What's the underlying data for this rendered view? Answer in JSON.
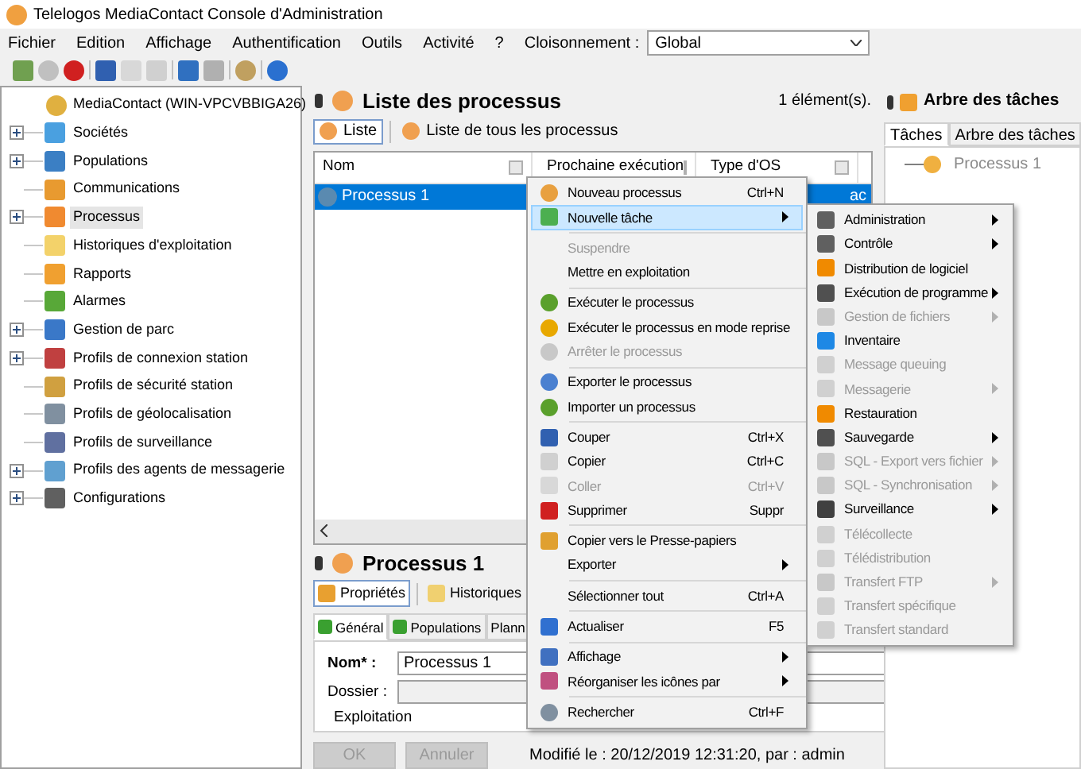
{
  "window": {
    "title": "Telelogos MediaContact Console d'Administration"
  },
  "menu_bar": {
    "items": [
      "Fichier",
      "Edition",
      "Affichage",
      "Authentification",
      "Outils",
      "Activité",
      "?"
    ],
    "partition_label": "Cloisonnement :",
    "partition_value": "Global"
  },
  "tree": {
    "root": "MediaContact (WIN-VPCVBBIGA26)",
    "items": [
      {
        "label": "Sociétés",
        "expandable": true,
        "selected": false
      },
      {
        "label": "Populations",
        "expandable": true,
        "selected": false
      },
      {
        "label": "Communications",
        "expandable": false,
        "selected": false
      },
      {
        "label": "Processus",
        "expandable": true,
        "selected": true
      },
      {
        "label": "Historiques d'exploitation",
        "expandable": false,
        "selected": false
      },
      {
        "label": "Rapports",
        "expandable": false,
        "selected": false
      },
      {
        "label": "Alarmes",
        "expandable": false,
        "selected": false
      },
      {
        "label": "Gestion de parc",
        "expandable": true,
        "selected": false
      },
      {
        "label": "Profils de connexion station",
        "expandable": true,
        "selected": false
      },
      {
        "label": "Profils de sécurité station",
        "expandable": false,
        "selected": false
      },
      {
        "label": "Profils de géolocalisation",
        "expandable": false,
        "selected": false
      },
      {
        "label": "Profils de surveillance",
        "expandable": false,
        "selected": false
      },
      {
        "label": "Profils des agents de messagerie",
        "expandable": true,
        "selected": false
      },
      {
        "label": "Configurations",
        "expandable": true,
        "selected": false
      }
    ]
  },
  "process_list": {
    "title": "Liste des processus",
    "count": "1 élément(s).",
    "views": [
      {
        "label": "Liste",
        "selected": true
      },
      {
        "label": "Liste de tous les processus",
        "selected": false
      }
    ],
    "columns": [
      "Nom",
      "Prochaine exécution",
      "Type d'OS"
    ],
    "rows": [
      {
        "name": "Processus 1",
        "column_4": "ac",
        "selected": true
      }
    ]
  },
  "details": {
    "title": "Processus 1",
    "tabs": [
      {
        "label": "Propriétés",
        "selected": true
      },
      {
        "label": "Historiques",
        "selected": false
      }
    ],
    "subtabs": [
      {
        "label": "Général",
        "selected": true
      },
      {
        "label": "Populations",
        "selected": false
      },
      {
        "label": "Plann",
        "selected": false
      }
    ],
    "fields": [
      {
        "label": "Nom* :",
        "required": true,
        "value": "Processus 1"
      },
      {
        "label": "Dossier :",
        "required": false
      }
    ],
    "group_label": "Exploitation",
    "buttons": [
      {
        "label": "OK",
        "disabled": true
      },
      {
        "label": "Annuler",
        "disabled": true
      }
    ],
    "modified": "Modifié le : 20/12/2019 12:31:20, par : admin"
  },
  "task_tree": {
    "title": "Arbre des tâches",
    "tabs": [
      {
        "label": "Tâches",
        "selected": true
      },
      {
        "label": "Arbre des tâches",
        "selected": false
      }
    ],
    "items": [
      "Processus 1"
    ]
  },
  "context_menu": {
    "items": [
      {
        "kind": "item",
        "label": "Nouveau processus",
        "shortcut": "Ctrl+N",
        "disabled": false,
        "submenu": false,
        "selected": false
      },
      {
        "kind": "item",
        "label": "Nouvelle tâche",
        "disabled": false,
        "submenu": true,
        "selected": true
      },
      {
        "kind": "separator"
      },
      {
        "kind": "item",
        "label": "Suspendre",
        "disabled": true,
        "submenu": false,
        "selected": false
      },
      {
        "kind": "item",
        "label": "Mettre en exploitation",
        "disabled": false,
        "submenu": false,
        "selected": false
      },
      {
        "kind": "separator"
      },
      {
        "kind": "item",
        "label": "Exécuter le processus",
        "disabled": false,
        "submenu": false,
        "selected": false
      },
      {
        "kind": "item",
        "label": "Exécuter le processus en mode reprise",
        "disabled": false,
        "submenu": false,
        "selected": false
      },
      {
        "kind": "item",
        "label": "Arrêter le processus",
        "disabled": true,
        "submenu": false,
        "selected": false
      },
      {
        "kind": "separator"
      },
      {
        "kind": "item",
        "label": "Exporter le processus",
        "disabled": false,
        "submenu": false,
        "selected": false
      },
      {
        "kind": "item",
        "label": "Importer un processus",
        "disabled": false,
        "submenu": false,
        "selected": false
      },
      {
        "kind": "separator"
      },
      {
        "kind": "item",
        "label": "Couper",
        "shortcut": "Ctrl+X",
        "disabled": false,
        "submenu": false,
        "selected": false
      },
      {
        "kind": "item",
        "label": "Copier",
        "shortcut": "Ctrl+C",
        "disabled": false,
        "submenu": false,
        "selected": false
      },
      {
        "kind": "item",
        "label": "Coller",
        "shortcut": "Ctrl+V",
        "disabled": true,
        "submenu": false,
        "selected": false
      },
      {
        "kind": "item",
        "label": "Supprimer",
        "shortcut": "Suppr",
        "disabled": false,
        "submenu": false,
        "selected": false
      },
      {
        "kind": "separator"
      },
      {
        "kind": "item",
        "label": "Copier vers le Presse-papiers",
        "disabled": false,
        "submenu": false,
        "selected": false
      },
      {
        "kind": "item",
        "label": "Exporter",
        "disabled": false,
        "submenu": true,
        "selected": false
      },
      {
        "kind": "separator"
      },
      {
        "kind": "item",
        "label": "Sélectionner tout",
        "shortcut": "Ctrl+A",
        "disabled": false,
        "submenu": false,
        "selected": false
      },
      {
        "kind": "separator"
      },
      {
        "kind": "item",
        "label": "Actualiser",
        "shortcut": "F5",
        "disabled": false,
        "submenu": false,
        "selected": false
      },
      {
        "kind": "separator"
      },
      {
        "kind": "item",
        "label": "Affichage",
        "disabled": false,
        "submenu": true,
        "selected": false
      },
      {
        "kind": "item",
        "label": "Réorganiser les icônes par",
        "disabled": false,
        "submenu": true,
        "selected": false
      },
      {
        "kind": "separator"
      },
      {
        "kind": "item",
        "label": "Rechercher",
        "shortcut": "Ctrl+F",
        "disabled": false,
        "submenu": false,
        "selected": false
      }
    ]
  },
  "submenu": {
    "items": [
      {
        "label": "Administration",
        "disabled": false,
        "submenu": true
      },
      {
        "label": "Contrôle",
        "disabled": false,
        "submenu": true
      },
      {
        "label": "Distribution de logiciel",
        "disabled": false,
        "submenu": false
      },
      {
        "label": "Exécution de programme",
        "disabled": false,
        "submenu": true
      },
      {
        "label": "Gestion de fichiers",
        "disabled": true,
        "submenu": true
      },
      {
        "label": "Inventaire",
        "disabled": false,
        "submenu": false
      },
      {
        "label": "Message queuing",
        "disabled": true,
        "submenu": false
      },
      {
        "label": "Messagerie",
        "disabled": true,
        "submenu": true
      },
      {
        "label": "Restauration",
        "disabled": false,
        "submenu": false
      },
      {
        "label": "Sauvegarde",
        "disabled": false,
        "submenu": true
      },
      {
        "label": "SQL - Export vers fichier",
        "disabled": true,
        "submenu": true
      },
      {
        "label": "SQL - Synchronisation",
        "disabled": true,
        "submenu": true
      },
      {
        "label": "Surveillance",
        "disabled": false,
        "submenu": true
      },
      {
        "label": "Télécollecte",
        "disabled": true,
        "submenu": false
      },
      {
        "label": "Télédistribution",
        "disabled": true,
        "submenu": false
      },
      {
        "label": "Transfert FTP",
        "disabled": true,
        "submenu": true
      },
      {
        "label": "Transfert spécifique",
        "disabled": true,
        "submenu": false
      },
      {
        "label": "Transfert standard",
        "disabled": true,
        "submenu": false
      }
    ]
  }
}
